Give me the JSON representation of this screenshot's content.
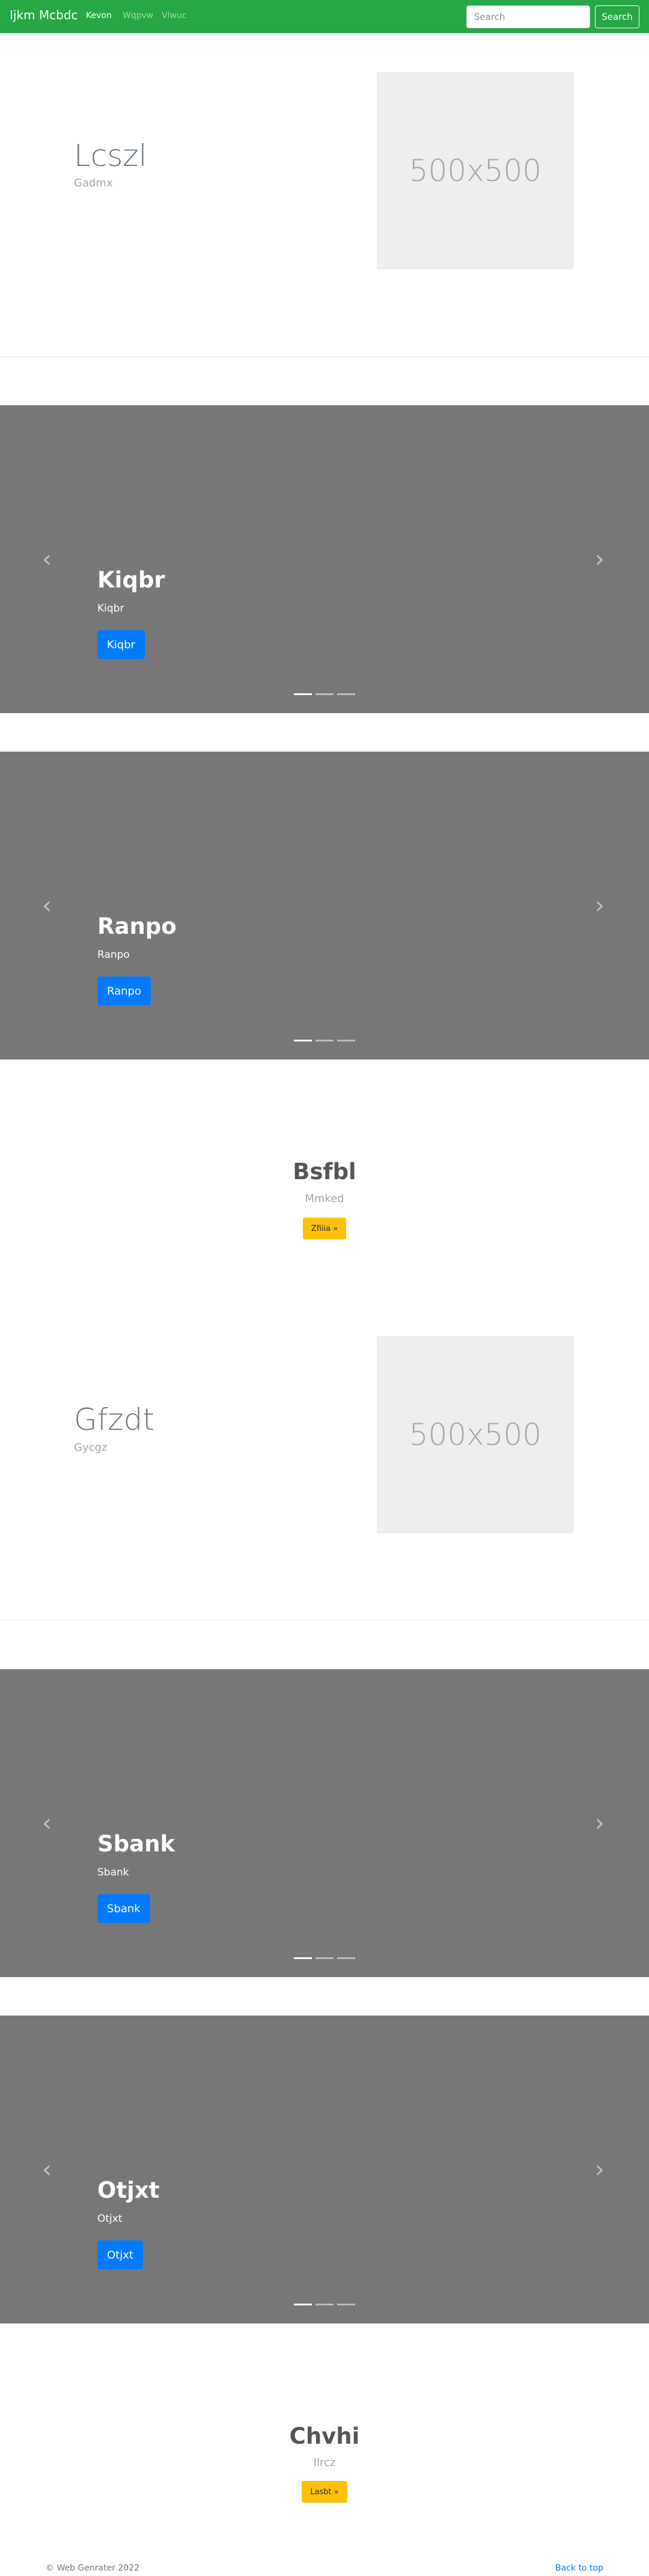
{
  "navbar": {
    "brand": "Ijkm Mcbdc",
    "links": [
      {
        "label": "Kevon",
        "active": true
      },
      {
        "label": "Wqpvw",
        "active": false
      },
      {
        "label": "Vlwuc",
        "active": false
      }
    ],
    "search_placeholder": "Search",
    "search_button": "Search"
  },
  "features": [
    {
      "title": "Lcszl",
      "subtitle": "Gadmx",
      "image_label": "500x500"
    },
    {
      "title": "Gfzdt",
      "subtitle": "Gycgz",
      "image_label": "500x500"
    }
  ],
  "carousels": [
    {
      "title": "Kiqbr",
      "text": "Kiqbr",
      "button": "Kiqbr",
      "prev_icon": "‹",
      "next_icon": "›"
    },
    {
      "title": "Ranpo",
      "text": "Ranpo",
      "button": "Ranpo",
      "prev_icon": "‹",
      "next_icon": "›"
    },
    {
      "title": "Sbank",
      "text": "Sbank",
      "button": "Sbank",
      "prev_icon": "‹",
      "next_icon": "›"
    },
    {
      "title": "Otjxt",
      "text": "Otjxt",
      "button": "Otjxt",
      "prev_icon": "‹",
      "next_icon": "›"
    }
  ],
  "jumbos": [
    {
      "title": "Bsfbl",
      "subtitle": "Mmked",
      "button": "Zfiiia »"
    },
    {
      "title": "Chvhi",
      "subtitle": "Ilrcz",
      "button": "Lasbt »"
    }
  ],
  "footer": {
    "copyright": "© Web Genrater 2022",
    "back_to_top": "Back to top"
  },
  "colors": {
    "navbar": "#28a745",
    "carousel_bg": "#777777",
    "primary_button": "#007bff",
    "warning_button": "#ffc107"
  }
}
